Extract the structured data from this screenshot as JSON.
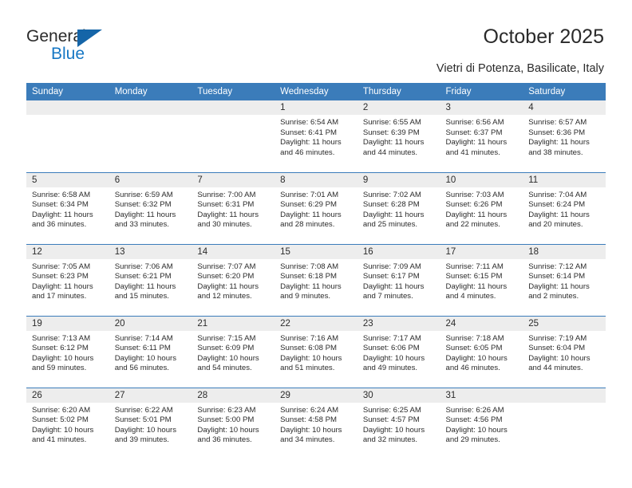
{
  "brand": {
    "name_part1": "General",
    "name_part2": "Blue",
    "accent_color": "#1677c4",
    "triangle_color": "#1565a8",
    "logo_icon": "triangle-icon"
  },
  "header": {
    "title": "October 2025",
    "subtitle": "Vietri di Potenza, Basilicate, Italy"
  },
  "theme": {
    "header_row_bg": "#3b7cba",
    "header_row_text": "#ffffff",
    "daynum_band_bg": "#ededed",
    "row_divider": "#3b7cba",
    "body_text": "#2b2b2b"
  },
  "calendar": {
    "weekday_headers": [
      "Sunday",
      "Monday",
      "Tuesday",
      "Wednesday",
      "Thursday",
      "Friday",
      "Saturday"
    ],
    "labels": {
      "sunrise_prefix": "Sunrise:",
      "sunset_prefix": "Sunset:",
      "daylight_prefix": "Daylight:"
    },
    "weeks": [
      [
        {
          "day": "",
          "blank": true,
          "sunrise": "",
          "sunset": "",
          "daylight_line1": "",
          "daylight_line2": ""
        },
        {
          "day": "",
          "blank": true,
          "sunrise": "",
          "sunset": "",
          "daylight_line1": "",
          "daylight_line2": ""
        },
        {
          "day": "",
          "blank": true,
          "sunrise": "",
          "sunset": "",
          "daylight_line1": "",
          "daylight_line2": ""
        },
        {
          "day": "1",
          "blank": false,
          "sunrise": "Sunrise: 6:54 AM",
          "sunset": "Sunset: 6:41 PM",
          "daylight_line1": "Daylight: 11 hours",
          "daylight_line2": "and 46 minutes."
        },
        {
          "day": "2",
          "blank": false,
          "sunrise": "Sunrise: 6:55 AM",
          "sunset": "Sunset: 6:39 PM",
          "daylight_line1": "Daylight: 11 hours",
          "daylight_line2": "and 44 minutes."
        },
        {
          "day": "3",
          "blank": false,
          "sunrise": "Sunrise: 6:56 AM",
          "sunset": "Sunset: 6:37 PM",
          "daylight_line1": "Daylight: 11 hours",
          "daylight_line2": "and 41 minutes."
        },
        {
          "day": "4",
          "blank": false,
          "sunrise": "Sunrise: 6:57 AM",
          "sunset": "Sunset: 6:36 PM",
          "daylight_line1": "Daylight: 11 hours",
          "daylight_line2": "and 38 minutes."
        }
      ],
      [
        {
          "day": "5",
          "blank": false,
          "sunrise": "Sunrise: 6:58 AM",
          "sunset": "Sunset: 6:34 PM",
          "daylight_line1": "Daylight: 11 hours",
          "daylight_line2": "and 36 minutes."
        },
        {
          "day": "6",
          "blank": false,
          "sunrise": "Sunrise: 6:59 AM",
          "sunset": "Sunset: 6:32 PM",
          "daylight_line1": "Daylight: 11 hours",
          "daylight_line2": "and 33 minutes."
        },
        {
          "day": "7",
          "blank": false,
          "sunrise": "Sunrise: 7:00 AM",
          "sunset": "Sunset: 6:31 PM",
          "daylight_line1": "Daylight: 11 hours",
          "daylight_line2": "and 30 minutes."
        },
        {
          "day": "8",
          "blank": false,
          "sunrise": "Sunrise: 7:01 AM",
          "sunset": "Sunset: 6:29 PM",
          "daylight_line1": "Daylight: 11 hours",
          "daylight_line2": "and 28 minutes."
        },
        {
          "day": "9",
          "blank": false,
          "sunrise": "Sunrise: 7:02 AM",
          "sunset": "Sunset: 6:28 PM",
          "daylight_line1": "Daylight: 11 hours",
          "daylight_line2": "and 25 minutes."
        },
        {
          "day": "10",
          "blank": false,
          "sunrise": "Sunrise: 7:03 AM",
          "sunset": "Sunset: 6:26 PM",
          "daylight_line1": "Daylight: 11 hours",
          "daylight_line2": "and 22 minutes."
        },
        {
          "day": "11",
          "blank": false,
          "sunrise": "Sunrise: 7:04 AM",
          "sunset": "Sunset: 6:24 PM",
          "daylight_line1": "Daylight: 11 hours",
          "daylight_line2": "and 20 minutes."
        }
      ],
      [
        {
          "day": "12",
          "blank": false,
          "sunrise": "Sunrise: 7:05 AM",
          "sunset": "Sunset: 6:23 PM",
          "daylight_line1": "Daylight: 11 hours",
          "daylight_line2": "and 17 minutes."
        },
        {
          "day": "13",
          "blank": false,
          "sunrise": "Sunrise: 7:06 AM",
          "sunset": "Sunset: 6:21 PM",
          "daylight_line1": "Daylight: 11 hours",
          "daylight_line2": "and 15 minutes."
        },
        {
          "day": "14",
          "blank": false,
          "sunrise": "Sunrise: 7:07 AM",
          "sunset": "Sunset: 6:20 PM",
          "daylight_line1": "Daylight: 11 hours",
          "daylight_line2": "and 12 minutes."
        },
        {
          "day": "15",
          "blank": false,
          "sunrise": "Sunrise: 7:08 AM",
          "sunset": "Sunset: 6:18 PM",
          "daylight_line1": "Daylight: 11 hours",
          "daylight_line2": "and 9 minutes."
        },
        {
          "day": "16",
          "blank": false,
          "sunrise": "Sunrise: 7:09 AM",
          "sunset": "Sunset: 6:17 PM",
          "daylight_line1": "Daylight: 11 hours",
          "daylight_line2": "and 7 minutes."
        },
        {
          "day": "17",
          "blank": false,
          "sunrise": "Sunrise: 7:11 AM",
          "sunset": "Sunset: 6:15 PM",
          "daylight_line1": "Daylight: 11 hours",
          "daylight_line2": "and 4 minutes."
        },
        {
          "day": "18",
          "blank": false,
          "sunrise": "Sunrise: 7:12 AM",
          "sunset": "Sunset: 6:14 PM",
          "daylight_line1": "Daylight: 11 hours",
          "daylight_line2": "and 2 minutes."
        }
      ],
      [
        {
          "day": "19",
          "blank": false,
          "sunrise": "Sunrise: 7:13 AM",
          "sunset": "Sunset: 6:12 PM",
          "daylight_line1": "Daylight: 10 hours",
          "daylight_line2": "and 59 minutes."
        },
        {
          "day": "20",
          "blank": false,
          "sunrise": "Sunrise: 7:14 AM",
          "sunset": "Sunset: 6:11 PM",
          "daylight_line1": "Daylight: 10 hours",
          "daylight_line2": "and 56 minutes."
        },
        {
          "day": "21",
          "blank": false,
          "sunrise": "Sunrise: 7:15 AM",
          "sunset": "Sunset: 6:09 PM",
          "daylight_line1": "Daylight: 10 hours",
          "daylight_line2": "and 54 minutes."
        },
        {
          "day": "22",
          "blank": false,
          "sunrise": "Sunrise: 7:16 AM",
          "sunset": "Sunset: 6:08 PM",
          "daylight_line1": "Daylight: 10 hours",
          "daylight_line2": "and 51 minutes."
        },
        {
          "day": "23",
          "blank": false,
          "sunrise": "Sunrise: 7:17 AM",
          "sunset": "Sunset: 6:06 PM",
          "daylight_line1": "Daylight: 10 hours",
          "daylight_line2": "and 49 minutes."
        },
        {
          "day": "24",
          "blank": false,
          "sunrise": "Sunrise: 7:18 AM",
          "sunset": "Sunset: 6:05 PM",
          "daylight_line1": "Daylight: 10 hours",
          "daylight_line2": "and 46 minutes."
        },
        {
          "day": "25",
          "blank": false,
          "sunrise": "Sunrise: 7:19 AM",
          "sunset": "Sunset: 6:04 PM",
          "daylight_line1": "Daylight: 10 hours",
          "daylight_line2": "and 44 minutes."
        }
      ],
      [
        {
          "day": "26",
          "blank": false,
          "sunrise": "Sunrise: 6:20 AM",
          "sunset": "Sunset: 5:02 PM",
          "daylight_line1": "Daylight: 10 hours",
          "daylight_line2": "and 41 minutes."
        },
        {
          "day": "27",
          "blank": false,
          "sunrise": "Sunrise: 6:22 AM",
          "sunset": "Sunset: 5:01 PM",
          "daylight_line1": "Daylight: 10 hours",
          "daylight_line2": "and 39 minutes."
        },
        {
          "day": "28",
          "blank": false,
          "sunrise": "Sunrise: 6:23 AM",
          "sunset": "Sunset: 5:00 PM",
          "daylight_line1": "Daylight: 10 hours",
          "daylight_line2": "and 36 minutes."
        },
        {
          "day": "29",
          "blank": false,
          "sunrise": "Sunrise: 6:24 AM",
          "sunset": "Sunset: 4:58 PM",
          "daylight_line1": "Daylight: 10 hours",
          "daylight_line2": "and 34 minutes."
        },
        {
          "day": "30",
          "blank": false,
          "sunrise": "Sunrise: 6:25 AM",
          "sunset": "Sunset: 4:57 PM",
          "daylight_line1": "Daylight: 10 hours",
          "daylight_line2": "and 32 minutes."
        },
        {
          "day": "31",
          "blank": false,
          "sunrise": "Sunrise: 6:26 AM",
          "sunset": "Sunset: 4:56 PM",
          "daylight_line1": "Daylight: 10 hours",
          "daylight_line2": "and 29 minutes."
        },
        {
          "day": "",
          "blank": true,
          "sunrise": "",
          "sunset": "",
          "daylight_line1": "",
          "daylight_line2": ""
        }
      ]
    ]
  }
}
